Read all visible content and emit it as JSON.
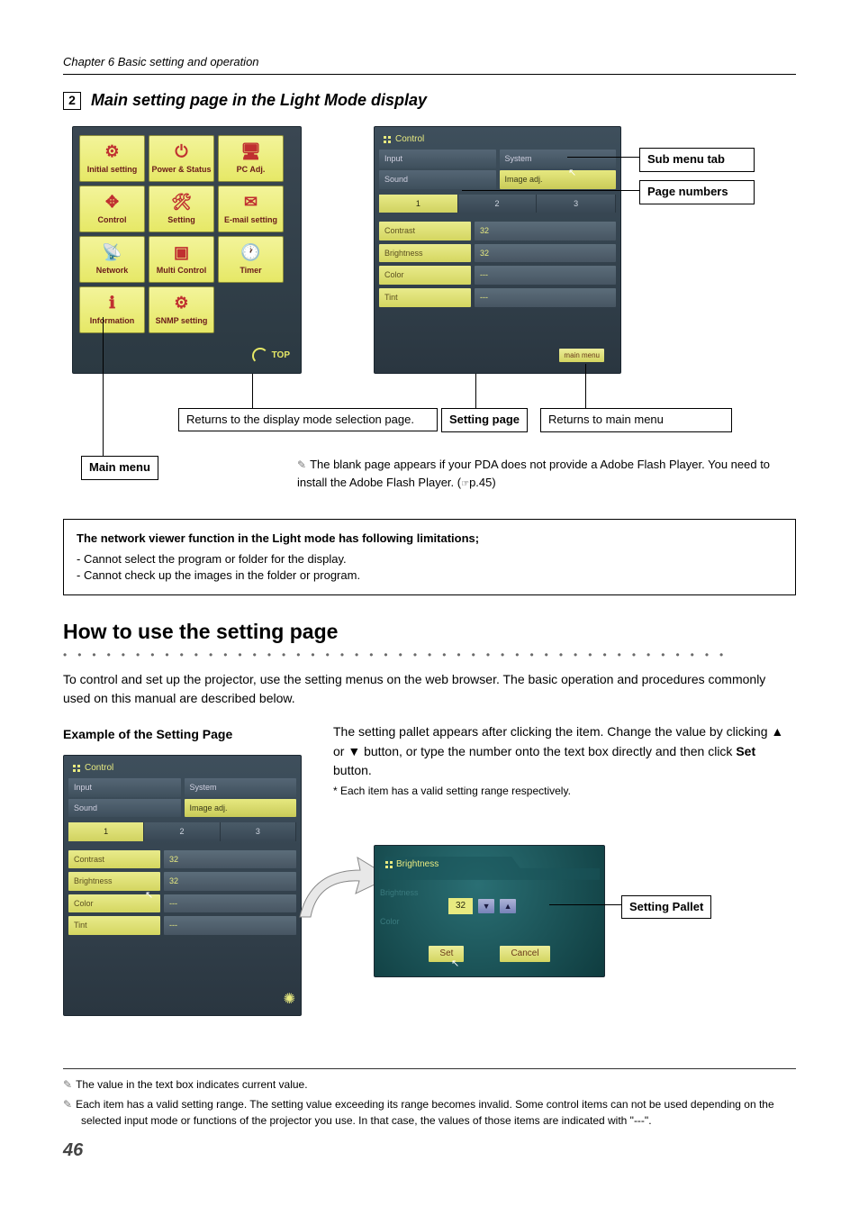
{
  "header": {
    "chapter": "Chapter 6 Basic setting and operation"
  },
  "section": {
    "num": "2",
    "title": "Main setting page in the Light Mode display"
  },
  "main_menu": {
    "tiles": [
      {
        "label": "Initial setting"
      },
      {
        "label": "Power & Status"
      },
      {
        "label": "PC Adj."
      },
      {
        "label": "Control"
      },
      {
        "label": "Setting"
      },
      {
        "label": "E-mail setting"
      },
      {
        "label": "Network"
      },
      {
        "label": "Multi Control"
      },
      {
        "label": "Timer"
      },
      {
        "label": "Information"
      },
      {
        "label": "SNMP setting"
      }
    ],
    "top_label": "TOP"
  },
  "control_panel": {
    "title": "Control",
    "tabs": [
      {
        "label": "Input",
        "active": false
      },
      {
        "label": "System",
        "active": false
      },
      {
        "label": "Sound",
        "active": false
      },
      {
        "label": "Image adj.",
        "active": true
      }
    ],
    "pills": [
      {
        "label": "1",
        "active": true
      },
      {
        "label": "2",
        "active": false
      },
      {
        "label": "3",
        "active": false
      }
    ],
    "rows": [
      {
        "label": "Contrast",
        "value": "32"
      },
      {
        "label": "Brightness",
        "value": "32"
      },
      {
        "label": "Color",
        "value": "---"
      },
      {
        "label": "Tint",
        "value": "---"
      }
    ],
    "main_menu_btn": "main menu"
  },
  "callouts": {
    "sub_menu": "Sub menu tab",
    "page_numbers": "Page numbers",
    "setting_page": "Setting page",
    "returns_main": "Returns to main menu",
    "returns_display": "Returns to the display mode selection page.",
    "main_menu_label": "Main menu",
    "blank_page_note": "The blank page appears if your PDA does not provide a Adobe Flash Player. You need to install the Adobe Flash Player. (",
    "blank_page_ref": "p.45)"
  },
  "limitations": {
    "title": "The network viewer function in the Light mode has following limitations;",
    "items": [
      "- Cannot select the program or folder for the display.",
      "- Cannot check up the images in the folder or program."
    ]
  },
  "how_to": {
    "title": "How to use the setting page",
    "intro": "To control and set up the projector, use the setting menus on the web browser. The basic operation and procedures commonly used on this manual are described below.",
    "example_title": "Example of the Setting Page",
    "desc1": "The setting pallet appears after clicking the item. Change the value by clicking ▲ or ▼ button, or type the number onto the text box directly and then click ",
    "desc_set": "Set",
    "desc2": " button.",
    "desc_small": "* Each item has a valid setting range respectively.",
    "setting_pallet_label": "Setting Pallet"
  },
  "zoom": {
    "title": "Brightness",
    "side_brightness": "Brightness",
    "side_color": "Color",
    "value": "32",
    "set": "Set",
    "cancel": "Cancel"
  },
  "footnotes": {
    "f1": "The value in the text box indicates current value.",
    "f2": "Each item has a valid setting range. The setting value exceeding its range becomes invalid. Some control items can not be used depending on the selected input mode or functions of the projector you use. In that case, the values of those items are indicated with \"---\"."
  },
  "page_number": "46"
}
